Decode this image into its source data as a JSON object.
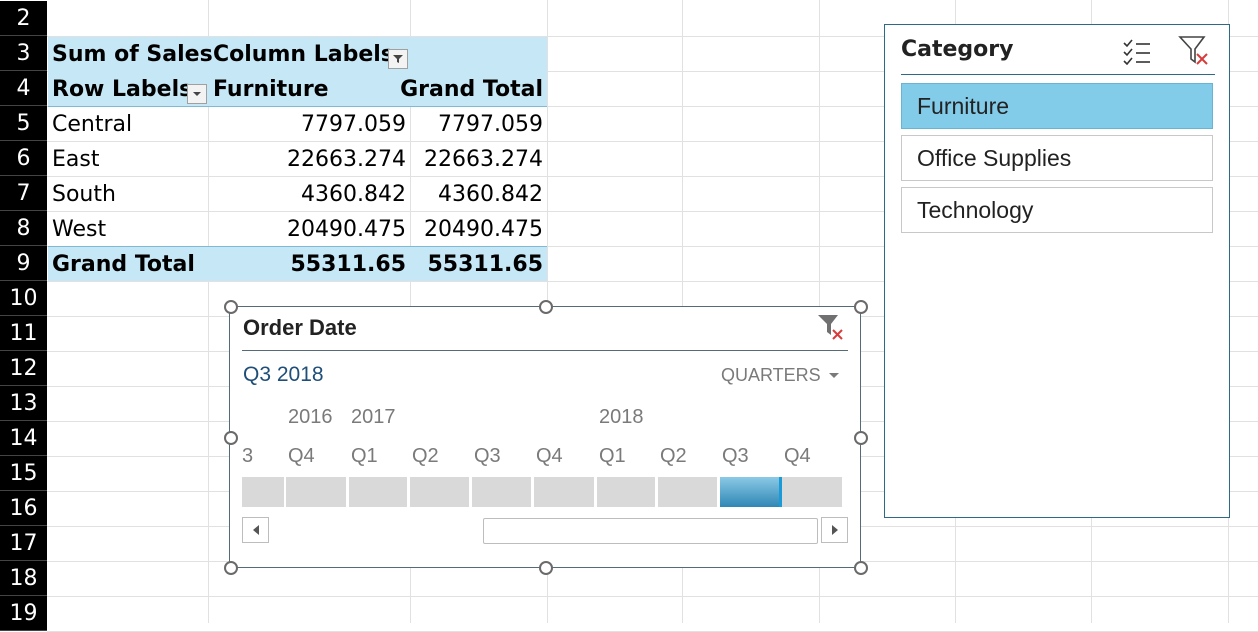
{
  "rows": [
    "2",
    "3",
    "4",
    "5",
    "6",
    "7",
    "8",
    "9",
    "10",
    "11",
    "12",
    "13",
    "14",
    "15",
    "16",
    "17",
    "18",
    "19"
  ],
  "pivot": {
    "value_label": "Sum of Sales",
    "column_labels": "Column Labels",
    "row_labels": "Row Labels",
    "col_furniture": "Furniture",
    "col_grand_total": "Grand Total",
    "data": [
      {
        "region": "Central",
        "furniture": "7797.059",
        "total": "7797.059"
      },
      {
        "region": "East",
        "furniture": "22663.274",
        "total": "22663.274"
      },
      {
        "region": "South",
        "furniture": "4360.842",
        "total": "4360.842"
      },
      {
        "region": "West",
        "furniture": "20490.475",
        "total": "20490.475"
      }
    ],
    "grand_total_label": "Grand Total",
    "grand_total_furniture": "55311.65",
    "grand_total_total": "55311.65"
  },
  "slicer": {
    "title": "Category",
    "items": [
      {
        "label": "Furniture",
        "selected": true
      },
      {
        "label": "Office Supplies",
        "selected": false
      },
      {
        "label": "Technology",
        "selected": false
      }
    ]
  },
  "timeline": {
    "title": "Order Date",
    "selection": "Q3 2018",
    "level": "QUARTERS",
    "years": [
      "2016",
      "2017",
      "2018"
    ],
    "quarters": [
      "3",
      "Q4",
      "Q1",
      "Q2",
      "Q3",
      "Q4",
      "Q1",
      "Q2",
      "Q3",
      "Q4"
    ],
    "selected_index": 8
  },
  "colors": {
    "accent": "#82cbe9",
    "pivot_header": "#c6e7f5",
    "row_header": "#000000"
  }
}
